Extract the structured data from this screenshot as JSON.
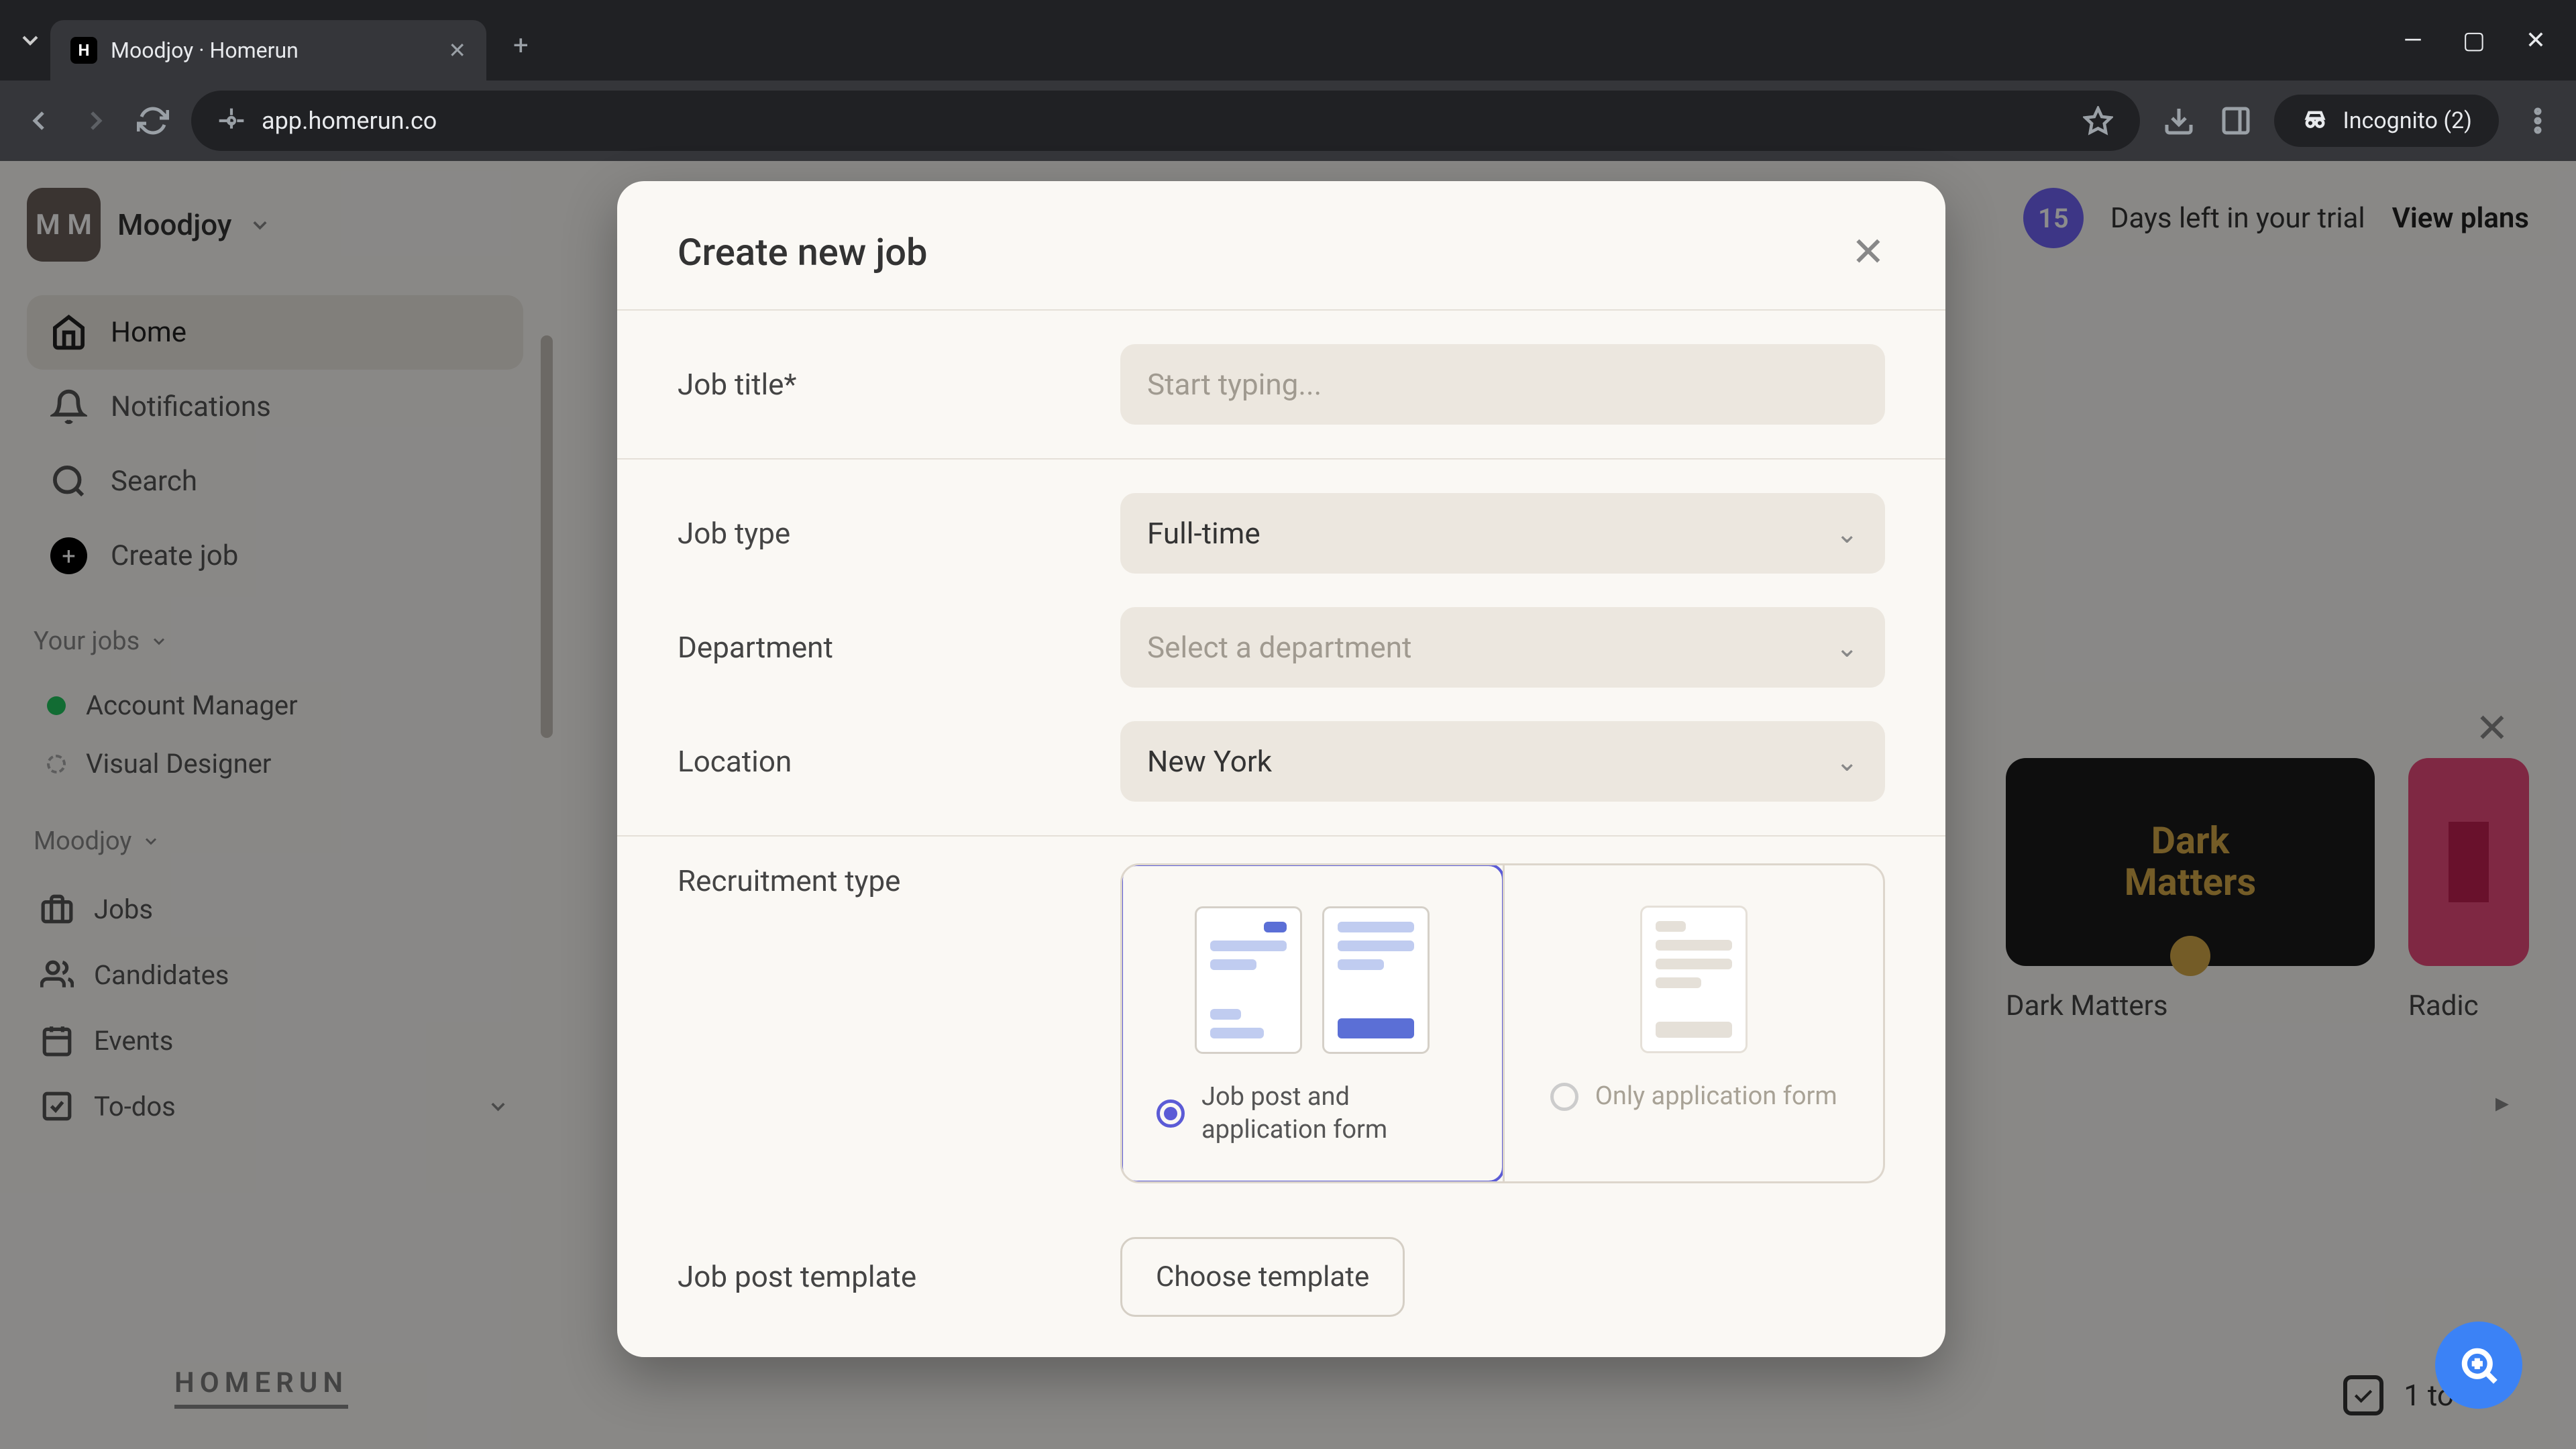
{
  "browser": {
    "tab_title": "Moodjoy · Homerun",
    "url": "app.homerun.co",
    "incognito_label": "Incognito (2)"
  },
  "sidebar": {
    "org_initials": "M M",
    "org_name": "Moodjoy",
    "nav": {
      "home": "Home",
      "notifications": "Notifications",
      "search": "Search",
      "create_job": "Create job"
    },
    "your_jobs_label": "Your jobs",
    "jobs": [
      {
        "name": "Account Manager",
        "status": "green"
      },
      {
        "name": "Visual Designer",
        "status": "empty"
      }
    ],
    "company_label": "Moodjoy",
    "sub": {
      "jobs": "Jobs",
      "candidates": "Candidates",
      "events": "Events",
      "todos": "To-dos"
    },
    "logo": "HOMERUN"
  },
  "trial": {
    "days": "15",
    "text": "Days left in your trial",
    "cta": "View plans"
  },
  "cards": [
    {
      "title": "Dark Matters",
      "art": "Dark\nMatters"
    },
    {
      "title": "Radic",
      "art": ""
    }
  ],
  "todo_peek": "1 to-do",
  "scroll_peek": "▸",
  "modal": {
    "title": "Create new job",
    "fields": {
      "job_title_label": "Job title*",
      "job_title_placeholder": "Start typing...",
      "job_type_label": "Job type",
      "job_type_value": "Full-time",
      "department_label": "Department",
      "department_placeholder": "Select a department",
      "location_label": "Location",
      "location_value": "New York",
      "recruitment_type_label": "Recruitment type",
      "rec_opt1": "Job post and application form",
      "rec_opt2": "Only application form",
      "job_post_template_label": "Job post template",
      "choose_template": "Choose template"
    }
  }
}
